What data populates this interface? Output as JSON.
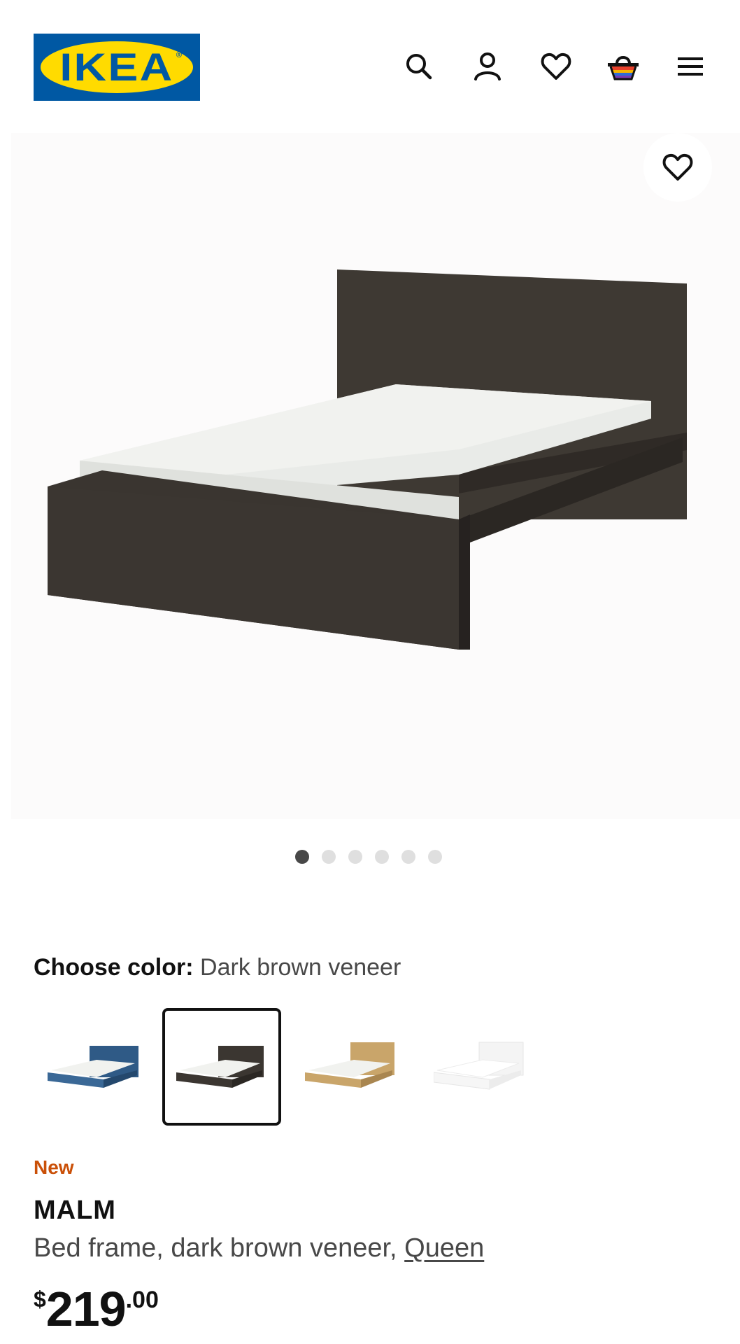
{
  "header": {
    "logo_text": "IKEA",
    "logo_reg": "®",
    "icons": [
      "search-icon",
      "account-icon",
      "heart-icon",
      "cart-icon",
      "menu-icon"
    ]
  },
  "gallery": {
    "image_count": 6,
    "active_index": 0
  },
  "color_chooser": {
    "label": "Choose color:",
    "value": "Dark brown veneer",
    "options": [
      {
        "name": "blue",
        "frame": "#2f5a86",
        "selected": false
      },
      {
        "name": "dark-brown",
        "frame": "#3b3631",
        "selected": true
      },
      {
        "name": "oak",
        "frame": "#c9a56a",
        "selected": false
      },
      {
        "name": "white",
        "frame": "#f4f4f4",
        "selected": false
      }
    ]
  },
  "product": {
    "badge": "New",
    "name": "MALM",
    "description_prefix": "Bed frame, dark brown veneer, ",
    "size_link": "Queen"
  },
  "price": {
    "currency": "$",
    "integer": "219",
    "decimal": ".00"
  },
  "colors": {
    "brand_blue": "#0058a3",
    "brand_yellow": "#ffdb00",
    "new_badge": "#ca5008"
  }
}
